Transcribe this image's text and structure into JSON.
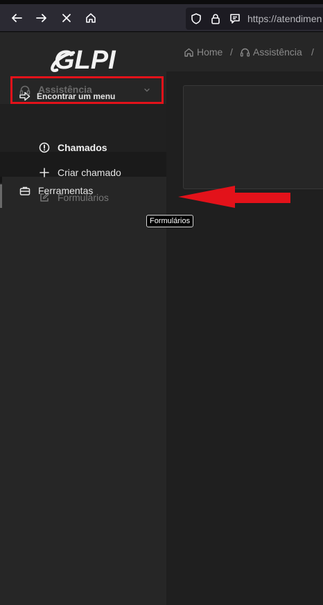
{
  "browser": {
    "url": "https://atendimen",
    "back_icon": "arrow-left-icon",
    "forward_icon": "arrow-right-icon",
    "stop_icon": "close-icon",
    "home_icon": "home-icon"
  },
  "sidebar": {
    "find_menu_label": "Encontrar um menu",
    "assist": {
      "label": "Assistência",
      "icon": "headset-icon",
      "expanded": true
    },
    "submenu": [
      {
        "label": "Chamados",
        "icon": "alert-circle-icon"
      },
      {
        "label": "Criar chamado",
        "icon": "plus-icon"
      },
      {
        "label": "Formulários",
        "icon": "edit-icon"
      }
    ],
    "tools": {
      "label": "Ferramentas",
      "icon": "briefcase-icon"
    }
  },
  "breadcrumb": {
    "home": "Home",
    "section": "Assistência",
    "separator": "/"
  },
  "tooltip": "Formulários",
  "colors": {
    "annotation_red": "#e3121a",
    "sidebar_bg": "#262626",
    "page_bg": "#1f1f1f"
  }
}
